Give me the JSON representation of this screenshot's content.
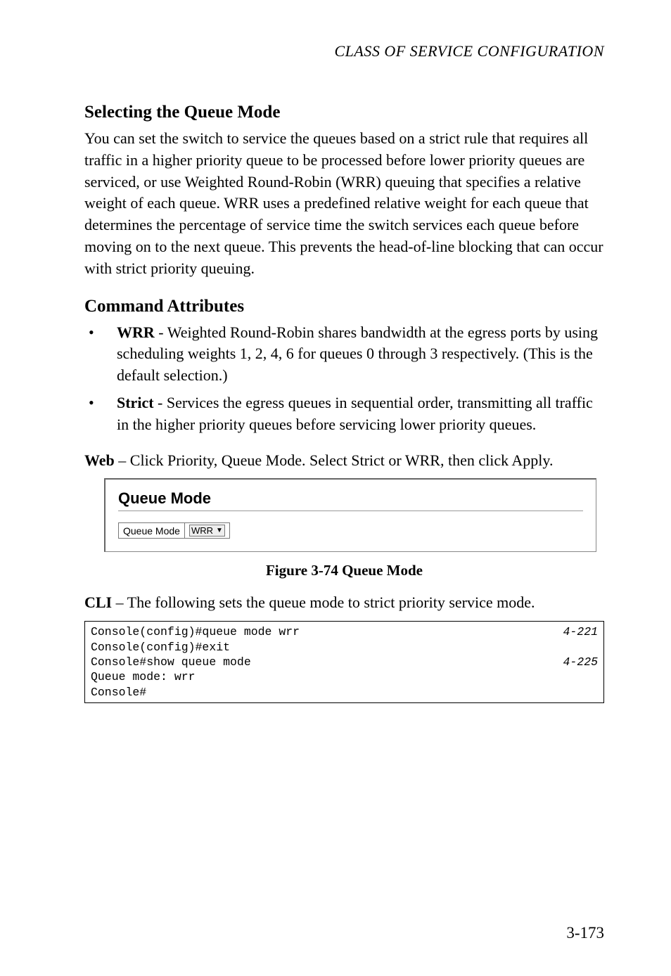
{
  "running_head": "CLASS OF SERVICE CONFIGURATION",
  "heading_selecting": "Selecting the Queue Mode",
  "para_selecting": "You can set the switch to service the queues based on a strict rule that requires all traffic in a higher priority queue to be processed before lower priority queues are serviced, or use Weighted Round-Robin (WRR) queuing that specifies a relative weight of each queue. WRR uses a predefined relative weight for each queue that determines the percentage of service time the switch services each queue before moving on to the next queue. This prevents the head-of-line blocking that can occur with strict priority queuing.",
  "heading_attrs": "Command Attributes",
  "bullets": {
    "marker": "•",
    "wrr_term": "WRR",
    "wrr_text": " - Weighted Round-Robin shares bandwidth at the egress ports by using scheduling weights 1, 2, 4, 6 for queues 0 through 3 respectively. (This is the default selection.)",
    "strict_term": "Strict",
    "strict_text": " - Services the egress queues in sequential order, transmitting all traffic in the higher priority queues before servicing lower priority queues."
  },
  "web_label": "Web",
  "web_text": " – Click Priority, Queue Mode. Select Strict or WRR, then click Apply.",
  "screenshot": {
    "title": "Queue Mode",
    "field_label": "Queue Mode",
    "select_value": "WRR"
  },
  "figure_caption": "Figure 3-74  Queue Mode",
  "cli_label": "CLI",
  "cli_text": " – The following sets the queue mode to strict priority service mode.",
  "code": {
    "l1_left": "Console(config)#queue mode wrr",
    "l1_right": "4-221",
    "l2_left": "Console(config)#exit",
    "l3_left": "Console#show queue mode",
    "l3_right": "4-225",
    "l4_left": "",
    "l5_left": "Queue mode: wrr",
    "l6_left": "Console#"
  },
  "page_number": "3-173"
}
